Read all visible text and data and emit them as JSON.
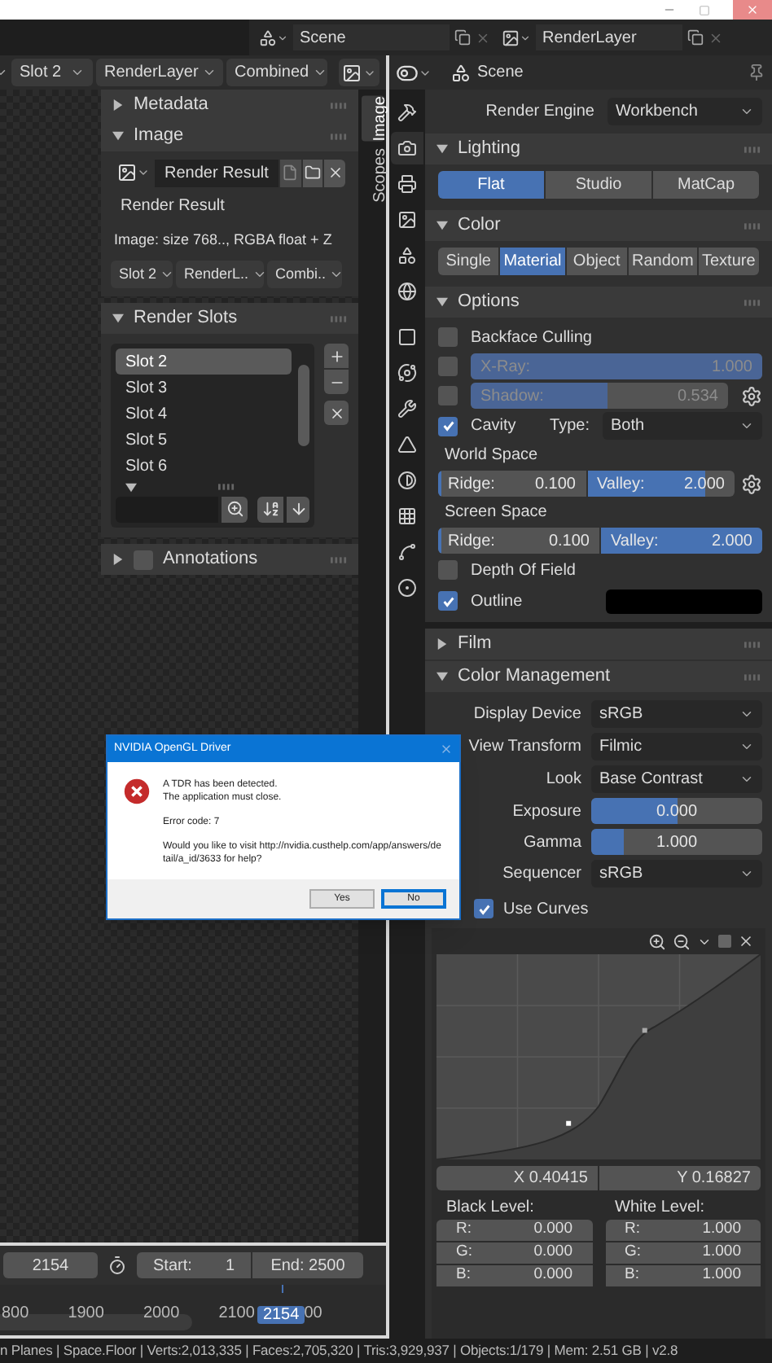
{
  "top_bar": {
    "scene": "Scene",
    "view_layer": "RenderLayer"
  },
  "image_editor": {
    "header": {
      "slot": "Slot 2",
      "layer": "RenderLayer",
      "pass": "Combined"
    },
    "tabs": [
      {
        "label": "Image",
        "selected": true
      },
      {
        "label": "Scopes",
        "selected": false
      }
    ],
    "metadata": {
      "title": "Metadata",
      "expanded": false
    },
    "image": {
      "title": "Image",
      "expanded": true,
      "image_name": "Render Result",
      "source": "Render Result",
      "info": "Image: size 768.., RGBA float + Z",
      "slot": "Slot 2",
      "layer": "RenderL..",
      "pass": "Combi.."
    },
    "render_slots": {
      "title": "Render Slots",
      "expanded": true,
      "slots": [
        {
          "label": "Slot 2",
          "selected": true
        },
        {
          "label": "Slot 3",
          "selected": false
        },
        {
          "label": "Slot 4",
          "selected": false
        },
        {
          "label": "Slot 5",
          "selected": false
        },
        {
          "label": "Slot 6",
          "selected": false
        }
      ]
    },
    "annotations": {
      "title": "Annotations",
      "expanded": false,
      "checked": false
    }
  },
  "timeline": {
    "current": "2154",
    "start_label": "Start:",
    "start": "1",
    "end": "End: 2500",
    "ruler": [
      {
        "label": "800",
        "current": false
      },
      {
        "label": "1900",
        "current": false
      },
      {
        "label": "2000",
        "current": false
      },
      {
        "label": "2100",
        "current": false
      },
      {
        "label": "2154",
        "current": true
      },
      {
        "label": "00",
        "current": false
      }
    ]
  },
  "properties": {
    "title": "Scene",
    "tabs": [
      {
        "kind": "tool",
        "selected": false
      },
      {
        "kind": "render",
        "selected": true
      },
      {
        "kind": "output",
        "selected": false
      },
      {
        "kind": "viewlayer",
        "selected": false
      },
      {
        "kind": "scene",
        "selected": false
      },
      {
        "kind": "world",
        "selected": false
      },
      {
        "kind": "object",
        "selected": false
      },
      {
        "kind": "physics",
        "selected": false
      },
      {
        "kind": "modifiers",
        "selected": false
      },
      {
        "kind": "particles",
        "selected": false
      },
      {
        "kind": "shading",
        "selected": false
      },
      {
        "kind": "texture",
        "selected": false
      },
      {
        "kind": "constraints",
        "selected": false
      },
      {
        "kind": "data",
        "selected": false
      }
    ],
    "render_engine": {
      "label": "Render Engine",
      "value": "Workbench"
    },
    "lighting": {
      "title": "Lighting",
      "expanded": true,
      "options": [
        {
          "label": "Flat",
          "selected": true
        },
        {
          "label": "Studio",
          "selected": false
        },
        {
          "label": "MatCap",
          "selected": false
        }
      ]
    },
    "color": {
      "title": "Color",
      "expanded": true,
      "options": [
        {
          "label": "Single",
          "selected": false
        },
        {
          "label": "Material",
          "selected": true
        },
        {
          "label": "Object",
          "selected": false
        },
        {
          "label": "Random",
          "selected": false
        },
        {
          "label": "Texture",
          "selected": false
        }
      ]
    },
    "options": {
      "title": "Options",
      "expanded": true,
      "rows": [
        {
          "kind": "check",
          "label": "Backface Culling",
          "checked": false
        },
        {
          "kind": "checkslider",
          "label": "X-Ray:",
          "value": "1.000",
          "level": 1,
          "checked": false,
          "gear": false
        },
        {
          "kind": "checkslider",
          "label": "Shadow:",
          "value": "0.534",
          "level": 0.534,
          "checked": false,
          "gear": true
        },
        {
          "kind": "checkselect",
          "label": "Cavity",
          "checked": true,
          "select_label": "Type:",
          "select_value": "Both"
        },
        {
          "kind": "heading",
          "label": "World Space"
        },
        {
          "kind": "pair",
          "gear": true,
          "fields": [
            {
              "label": "Ridge:",
              "value": "0.100",
              "level": 0.02
            },
            {
              "label": "Valley:",
              "value": "2.000",
              "level": 0.8
            }
          ]
        },
        {
          "kind": "heading",
          "label": "Screen Space"
        },
        {
          "kind": "pair",
          "gear": false,
          "fields": [
            {
              "label": "Ridge:",
              "value": "0.100",
              "level": 0.02
            },
            {
              "label": "Valley:",
              "value": "2.000",
              "level": 1
            }
          ]
        },
        {
          "kind": "check",
          "label": "Depth Of Field",
          "checked": false
        },
        {
          "kind": "checkcolor",
          "label": "Outline",
          "checked": true,
          "color": "#000000"
        }
      ]
    },
    "film": {
      "title": "Film",
      "expanded": false
    },
    "color_management": {
      "title": "Color Management",
      "expanded": true,
      "rows": [
        {
          "kind": "select",
          "label": "Display Device",
          "value": "sRGB"
        },
        {
          "kind": "select",
          "label": "View Transform",
          "value": "Filmic"
        },
        {
          "kind": "select",
          "label": "Look",
          "value": "Base Contrast"
        },
        {
          "kind": "slider",
          "label": "Exposure",
          "value": "0.000",
          "level": 0.5
        },
        {
          "kind": "slider",
          "label": "Gamma",
          "value": "1.000",
          "level": 0.19
        },
        {
          "kind": "select",
          "label": "Sequencer",
          "value": "sRGB"
        }
      ],
      "use_curves": {
        "label": "Use Curves",
        "checked": true
      },
      "curve": {
        "x": "X 0.40415",
        "y": "Y 0.16827"
      },
      "black_level": {
        "title": "Black Level:",
        "channels": [
          {
            "label": "R:",
            "value": "0.000"
          },
          {
            "label": "G:",
            "value": "0.000"
          },
          {
            "label": "B:",
            "value": "0.000"
          }
        ]
      },
      "white_level": {
        "title": "White Level:",
        "channels": [
          {
            "label": "R:",
            "value": "1.000"
          },
          {
            "label": "G:",
            "value": "1.000"
          },
          {
            "label": "B:",
            "value": "1.000"
          }
        ]
      }
    }
  },
  "status_bar": {
    "text": "n Planes | Space.Floor | Verts:2,013,335 | Faces:2,705,320 | Tris:3,929,937 | Objects:1/179 | Mem: 2.51 GB | v2.8"
  },
  "dialog": {
    "title": "NVIDIA OpenGL Driver",
    "lines": [
      "A TDR has been detected.",
      "The application must close."
    ],
    "code": "Error code: 7",
    "question": "Would you like to visit http://nvidia.custhelp.com/app/answers/detail/a_id/3633 for help?",
    "buttons": [
      {
        "label": "Yes",
        "selected": false
      },
      {
        "label": "No",
        "selected": true
      }
    ]
  }
}
